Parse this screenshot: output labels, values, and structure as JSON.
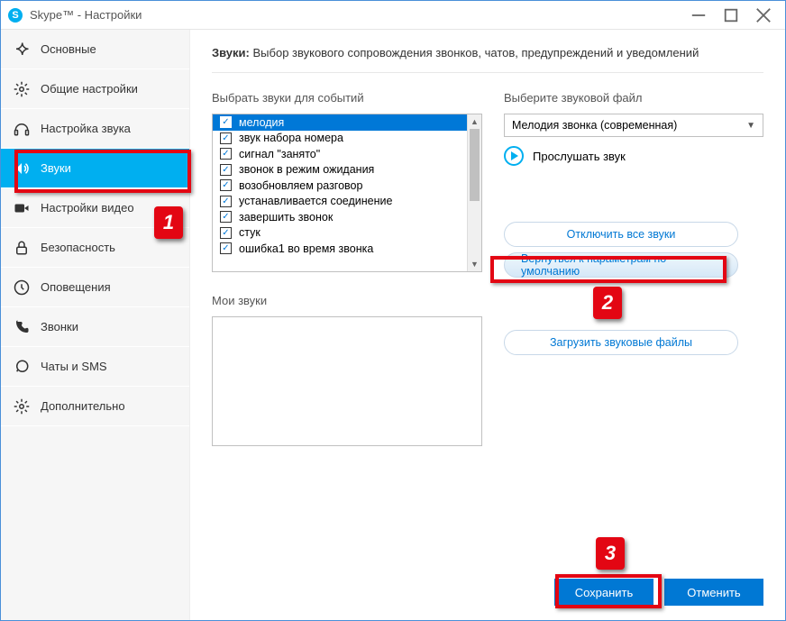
{
  "window": {
    "title": "Skype™ - Настройки"
  },
  "sidebar": {
    "items": [
      {
        "key": "general",
        "label": "Основные"
      },
      {
        "key": "general-settings",
        "label": "Общие настройки"
      },
      {
        "key": "audio-settings",
        "label": "Настройка звука"
      },
      {
        "key": "sounds",
        "label": "Звуки"
      },
      {
        "key": "video-settings",
        "label": "Настройки видео"
      },
      {
        "key": "security",
        "label": "Безопасность"
      },
      {
        "key": "notifications",
        "label": "Оповещения"
      },
      {
        "key": "calls",
        "label": "Звонки"
      },
      {
        "key": "chats-sms",
        "label": "Чаты и SMS"
      },
      {
        "key": "advanced",
        "label": "Дополнительно"
      }
    ],
    "active_index": 3
  },
  "header": {
    "title": "Звуки:",
    "desc": "Выбор звукового сопровождения звонков, чатов, предупреждений и уведомлений"
  },
  "events": {
    "label": "Выбрать звуки для событий",
    "selected_index": 0,
    "items": [
      {
        "label": "мелодия",
        "checked": true
      },
      {
        "label": "звук набора номера",
        "checked": true
      },
      {
        "label": "сигнал \"занято\"",
        "checked": true
      },
      {
        "label": "звонок в режим ожидания",
        "checked": true
      },
      {
        "label": "возобновляем разговор",
        "checked": true
      },
      {
        "label": "устанавливается соединение",
        "checked": true
      },
      {
        "label": "завершить звонок",
        "checked": true
      },
      {
        "label": "стук",
        "checked": true
      },
      {
        "label": "ошибка1 во время звонка",
        "checked": true
      }
    ]
  },
  "soundfile": {
    "label": "Выберите звуковой файл",
    "selected": "Мелодия звонка (современная)",
    "play_label": "Прослушать звук"
  },
  "actions": {
    "mute_all": "Отключить все звуки",
    "reset_defaults": "Вернуться к параметрам по умолчанию",
    "load_files": "Загрузить звуковые файлы"
  },
  "mysounds": {
    "label": "Мои звуки"
  },
  "footer": {
    "save": "Сохранить",
    "cancel": "Отменить"
  },
  "annotations": {
    "b1": "1",
    "b2": "2",
    "b3": "3"
  }
}
